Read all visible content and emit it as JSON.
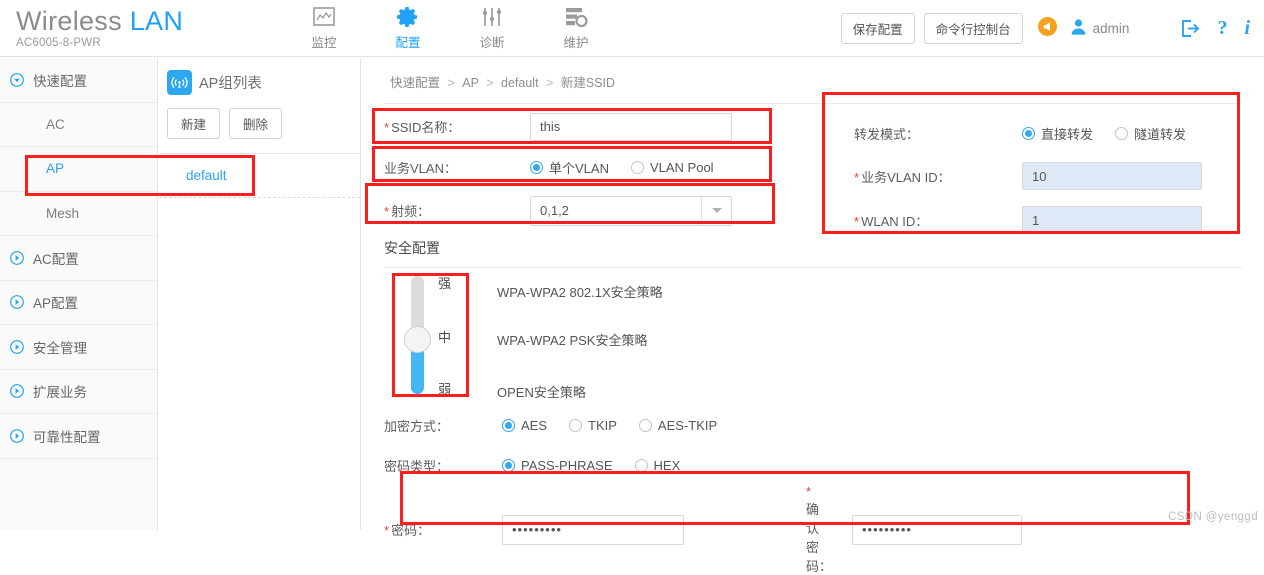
{
  "header": {
    "brand_main": "Wireless",
    "brand_accent": "LAN",
    "model": "AC6005-8-PWR",
    "nav": [
      {
        "label": "监控",
        "icon": "monitor-icon",
        "active": false
      },
      {
        "label": "配置",
        "icon": "gear-icon",
        "active": true
      },
      {
        "label": "诊断",
        "icon": "sliders-icon",
        "active": false
      },
      {
        "label": "维护",
        "icon": "maintenance-icon",
        "active": false
      }
    ],
    "save_config_label": "保存配置",
    "cli_console_label": "命令行控制台",
    "announce_icon": "megaphone-icon",
    "user_icon": "user-icon",
    "username": "admin",
    "logout_icon": "logout-icon",
    "help_icon": "question-icon",
    "about_icon": "info-icon"
  },
  "sidebar": {
    "items": [
      {
        "label": "快速配置",
        "type": "group",
        "icon": "chevron-down-circle-icon",
        "expanded": true
      },
      {
        "label": "AC",
        "type": "sub",
        "selected": false
      },
      {
        "label": "AP",
        "type": "sub",
        "selected": true
      },
      {
        "label": "Mesh",
        "type": "sub",
        "selected": false
      },
      {
        "label": "AC配置",
        "type": "group",
        "icon": "chevron-right-circle-icon",
        "expanded": false
      },
      {
        "label": "AP配置",
        "type": "group",
        "icon": "chevron-right-circle-icon",
        "expanded": false
      },
      {
        "label": "安全管理",
        "type": "group",
        "icon": "chevron-right-circle-icon",
        "expanded": false
      },
      {
        "label": "扩展业务",
        "type": "group",
        "icon": "chevron-right-circle-icon",
        "expanded": false
      },
      {
        "label": "可靠性配置",
        "type": "group",
        "icon": "chevron-right-circle-icon",
        "expanded": false
      }
    ]
  },
  "ap_group": {
    "panel_icon": "wifi-tower-icon",
    "title": "AP组列表",
    "new_label": "新建",
    "delete_label": "删除",
    "rows": [
      {
        "label": "default"
      }
    ]
  },
  "main": {
    "breadcrumb": [
      "快速配置",
      "AP",
      "default",
      "新建SSID"
    ],
    "breadcrumb_separator": ">",
    "left_form": {
      "ssid_label": "SSID名称：",
      "ssid_required": "*",
      "ssid_value": "this",
      "vlan_label": "业务VLAN：",
      "vlan_options": [
        {
          "label": "单个VLAN",
          "selected": true
        },
        {
          "label": "VLAN Pool",
          "selected": false
        }
      ],
      "radio_label": "射频：",
      "radio_required": "*",
      "radio_value": "0,1,2"
    },
    "right_form": {
      "forward_label": "转发模式：",
      "forward_options": [
        {
          "label": "直接转发",
          "selected": true
        },
        {
          "label": "隧道转发",
          "selected": false
        }
      ],
      "service_vlan_label": "业务VLAN ID：",
      "service_vlan_required": "*",
      "service_vlan_value": "10",
      "wlan_id_label": "WLAN ID：",
      "wlan_id_required": "*",
      "wlan_id_value": "1"
    },
    "security": {
      "section_title": "安全配置",
      "slider_ticks": {
        "top": "强",
        "middle": "中",
        "bottom": "弱"
      },
      "slider_position": "middle",
      "policies": [
        "WPA-WPA2 802.1X安全策略",
        "WPA-WPA2 PSK安全策略",
        "OPEN安全策略"
      ],
      "encryption_label": "加密方式：",
      "encryption_options": [
        {
          "label": "AES",
          "selected": true
        },
        {
          "label": "TKIP",
          "selected": false
        },
        {
          "label": "AES-TKIP",
          "selected": false
        }
      ],
      "password_type_label": "密码类型：",
      "password_type_options": [
        {
          "label": "PASS-PHRASE",
          "selected": true
        },
        {
          "label": "HEX",
          "selected": false
        }
      ],
      "password_label": "密码：",
      "password_required": "*",
      "password_value": "•••••••••",
      "confirm_label": "确认密码：",
      "confirm_required": "*",
      "confirm_value": "•••••••••"
    }
  },
  "watermark": "CSDN @yenggd",
  "colors": {
    "accent": "#20a0f7",
    "annotation": "#fc1d1d",
    "orange": "#f5a11e",
    "required": "#e8403a"
  }
}
